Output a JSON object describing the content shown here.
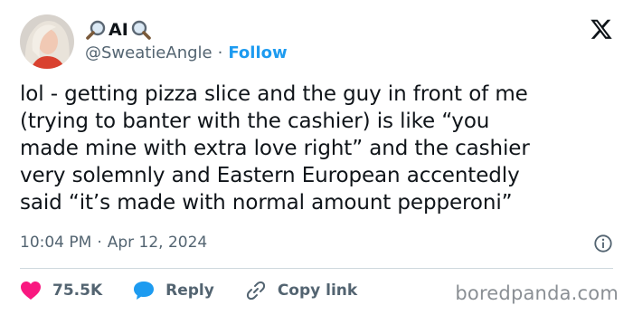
{
  "author": {
    "name": "AI",
    "handle": "@SweatieAngle",
    "separator": "·",
    "follow_label": "Follow"
  },
  "tweet": {
    "text": "lol - getting pizza slice and the guy in front of me\n(trying to banter with the cashier) is like “you\nmade mine with extra love right” and the cashier\nvery solemnly and Eastern European accentedly\nsaid “it’s made with normal amount pepperoni”",
    "time": "10:04 PM",
    "meta_separator": "·",
    "date": "Apr 12, 2024"
  },
  "actions": {
    "like_count": "75.5K",
    "reply_label": "Reply",
    "copy_link_label": "Copy link"
  },
  "watermark": "boredpanda.com",
  "colors": {
    "like": "#f91880",
    "reply": "#1d9bf0",
    "follow": "#1d9bf0",
    "secondary_text": "#536471"
  },
  "icons": {
    "name_prefix": "magnifying-glass-icon",
    "name_suffix": "magnifying-glass-icon",
    "brand": "x-logo-icon",
    "info": "info-icon",
    "like": "heart-icon",
    "reply": "speech-bubble-icon",
    "copy_link": "link-icon"
  }
}
